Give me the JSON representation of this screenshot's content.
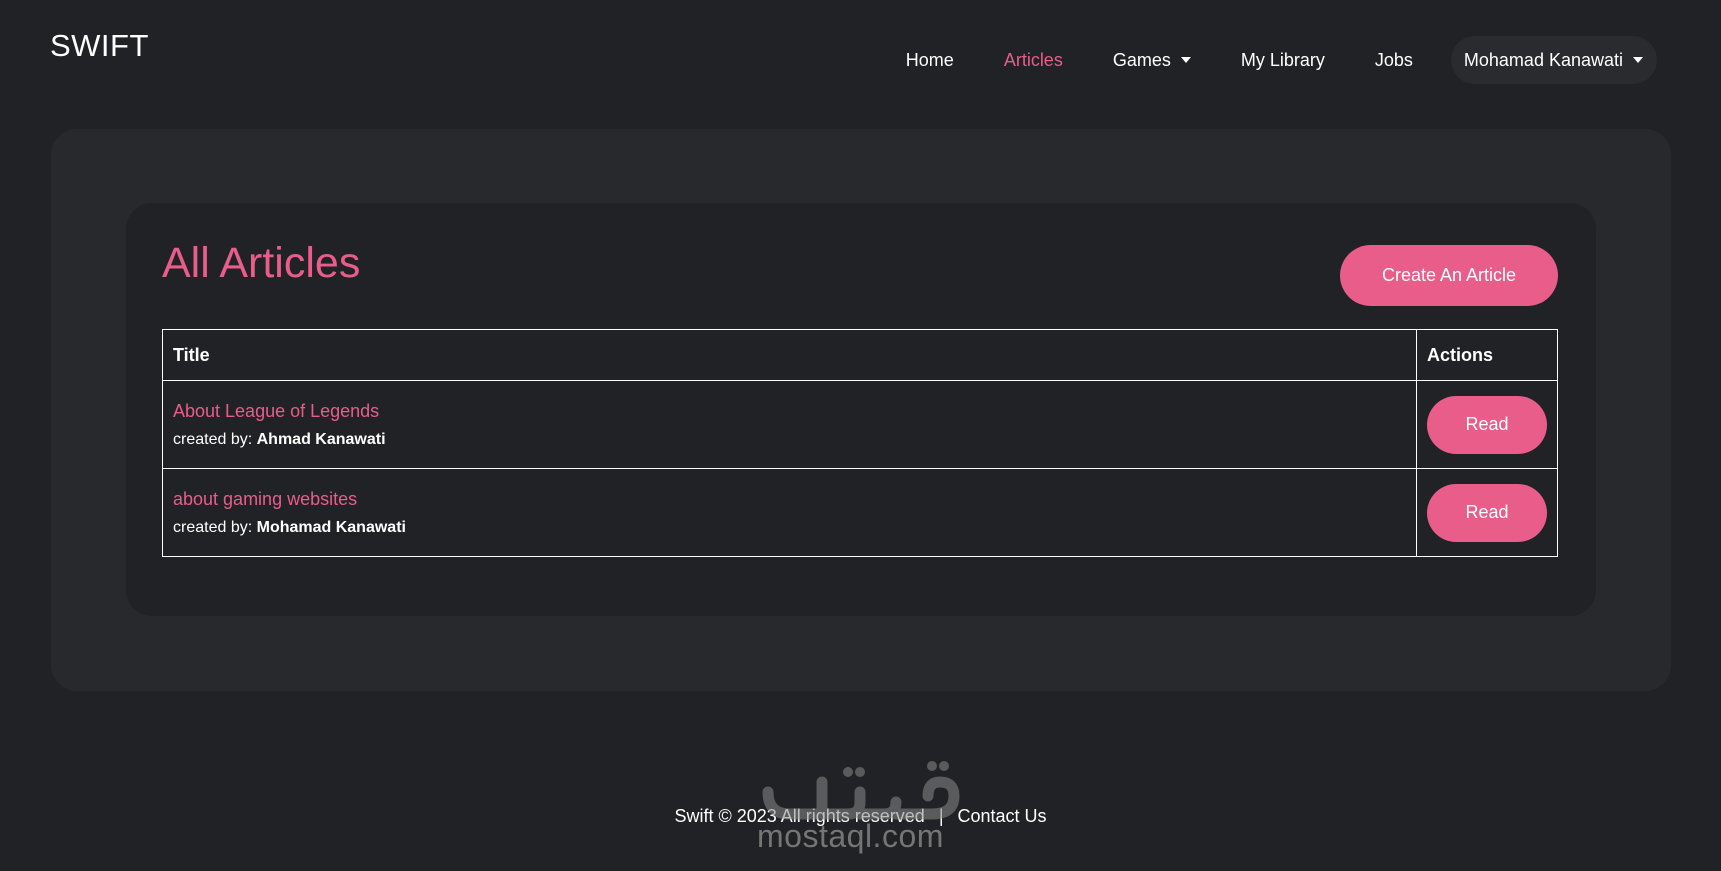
{
  "navbar": {
    "brand": "SWIFT",
    "links": [
      {
        "label": "Home",
        "active": false
      },
      {
        "label": "Articles",
        "active": true
      },
      {
        "label": "Games",
        "active": false,
        "dropdown": true
      },
      {
        "label": "My Library",
        "active": false
      },
      {
        "label": "Jobs",
        "active": false
      }
    ],
    "user_name": "Mohamad Kanawati"
  },
  "main": {
    "title": "All Articles",
    "create_button": "Create An Article",
    "table": {
      "headers": {
        "title": "Title",
        "actions": "Actions"
      },
      "rows": [
        {
          "title": "About League of Legends",
          "created_by_label": "created by:",
          "author": "Ahmad Kanawati",
          "action": "Read"
        },
        {
          "title": "about gaming websites",
          "created_by_label": "created by:",
          "author": "Mohamad Kanawati",
          "action": "Read"
        }
      ]
    }
  },
  "footer": {
    "copyright": "Swift © 2023 All rights reserved",
    "separator": "|",
    "contact": "Contact Us"
  },
  "watermark": {
    "text": "mostaql.com"
  },
  "colors": {
    "accent": "#e95d8b",
    "background": "#212225",
    "panel": "#28292c"
  }
}
